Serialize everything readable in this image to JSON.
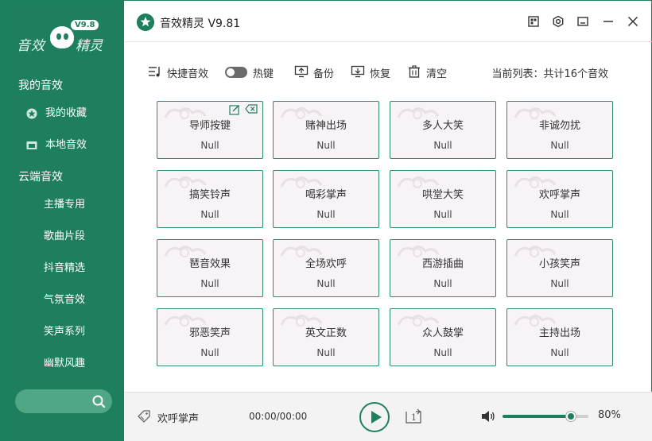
{
  "logo": {
    "text_left": "音效",
    "text_right": "精灵",
    "version_badge": "V9.8"
  },
  "sidebar": {
    "section_my": "我的音效",
    "my_items": [
      {
        "label": "我的收藏",
        "icon": "star-icon"
      },
      {
        "label": "本地音效",
        "icon": "folder-icon"
      }
    ],
    "section_cloud": "云端音效",
    "cloud_items": [
      "主播专用",
      "歌曲片段",
      "抖音精选",
      "气氛音效",
      "笑声系列",
      "幽默风趣"
    ],
    "search_placeholder": ""
  },
  "titlebar": {
    "title": "音效精灵 V9.81"
  },
  "toolbar": {
    "shortcut": "快捷音效",
    "hotkey": "热键",
    "hotkey_on": false,
    "backup": "备份",
    "restore": "恢复",
    "clear": "清空",
    "list_info": "当前列表：共计16个音效"
  },
  "cards": [
    {
      "name": "导师按键",
      "value": "Null"
    },
    {
      "name": "赌神出场",
      "value": "Null"
    },
    {
      "name": "多人大笑",
      "value": "Null"
    },
    {
      "name": "非诚勿扰",
      "value": "Null"
    },
    {
      "name": "搞笑铃声",
      "value": "Null"
    },
    {
      "name": "喝彩掌声",
      "value": "Null"
    },
    {
      "name": "哄堂大笑",
      "value": "Null"
    },
    {
      "name": "欢呼掌声",
      "value": "Null"
    },
    {
      "name": "琶音效果",
      "value": "Null"
    },
    {
      "name": "全场欢呼",
      "value": "Null"
    },
    {
      "name": "西游插曲",
      "value": "Null"
    },
    {
      "name": "小孩笑声",
      "value": "Null"
    },
    {
      "name": "邪恶笑声",
      "value": "Null"
    },
    {
      "name": "英文正数",
      "value": "Null"
    },
    {
      "name": "众人鼓掌",
      "value": "Null"
    },
    {
      "name": "主持出场",
      "value": "Null"
    }
  ],
  "player": {
    "now_playing": "欢呼掌声",
    "time": "00:00/00:00",
    "loop_count": "1",
    "volume_percent": 80,
    "volume_label": "80%"
  },
  "colors": {
    "accent": "#1e7f5e",
    "card_bg": "#f7f3f7",
    "card_border": "#2f8c69"
  }
}
